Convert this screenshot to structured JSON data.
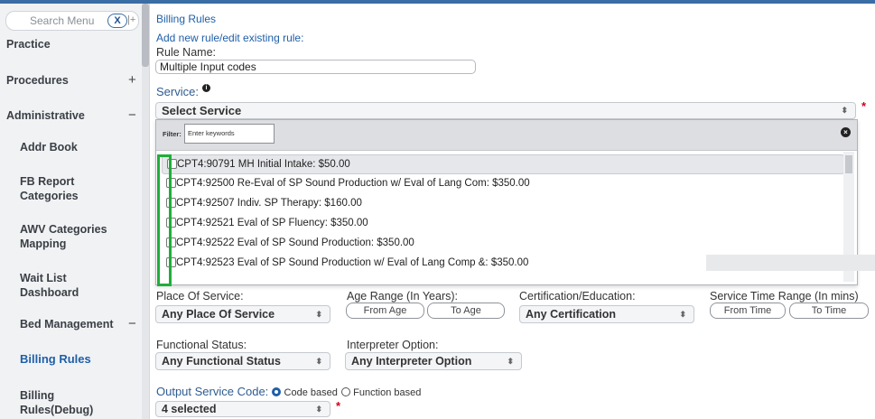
{
  "sidebar": {
    "search_placeholder": "Search Menu",
    "clear_label": "X",
    "pin_label": "|+",
    "items": [
      {
        "label": "Practice",
        "toggle": ""
      },
      {
        "label": "Procedures",
        "toggle": "+"
      },
      {
        "label": "Administrative",
        "toggle": "−"
      },
      {
        "label": "Addr Book",
        "toggle": ""
      },
      {
        "label": "FB Report Categories",
        "toggle": ""
      },
      {
        "label": "AWV Categories Mapping",
        "toggle": ""
      },
      {
        "label": "Wait List Dashboard",
        "toggle": ""
      },
      {
        "label": "Bed Management",
        "toggle": "−"
      },
      {
        "label": "Billing Rules",
        "toggle": ""
      },
      {
        "label": "Billing Rules(Debug)",
        "toggle": ""
      }
    ]
  },
  "main": {
    "page_title": "Billing Rules",
    "subtitle": "Add new rule/edit existing rule:",
    "rule_name_label": "Rule Name:",
    "rule_name_value": "Multiple Input codes",
    "service_label": "Service:",
    "service_info_icon": "info-icon",
    "service_select_value": "Select Service",
    "required_mark": "*",
    "filter_label": "Filter:",
    "filter_placeholder": "Enter keywords",
    "service_options": [
      "CPT4:90791 MH Initial Intake: $50.00",
      "CPT4:92500 Re-Eval of SP Sound Production w/ Eval of Lang Com: $350.00",
      "CPT4:92507 Indiv. SP Therapy: $160.00",
      "CPT4:92521 Eval of SP Fluency: $350.00",
      "CPT4:92522 Eval of SP Sound Production: $350.00",
      "CPT4:92523 Eval of SP Sound Production w/ Eval of Lang Comp &: $350.00"
    ],
    "place_of_service_label": "Place Of Service:",
    "place_of_service_value": "Any Place Of Service",
    "age_range_label": "Age Range (In Years):",
    "from_age": "From Age",
    "to_age": "To Age",
    "certification_label": "Certification/Education:",
    "certification_value": "Any Certification",
    "service_time_label": "Service Time Range (In mins)",
    "from_time": "From Time",
    "to_time": "To Time",
    "functional_status_label": "Functional Status:",
    "functional_status_value": "Any Functional Status",
    "interpreter_label": "Interpreter Option:",
    "interpreter_value": "Any Interpreter Option",
    "output_service_code_label": "Output Service Code:",
    "code_based_label": "Code based",
    "function_based_label": "Function based",
    "output_select_value": "4 selected"
  },
  "colors": {
    "accent": "#1f5fa8",
    "highlight_box": "#1fae3a",
    "required": "#d0021b"
  }
}
